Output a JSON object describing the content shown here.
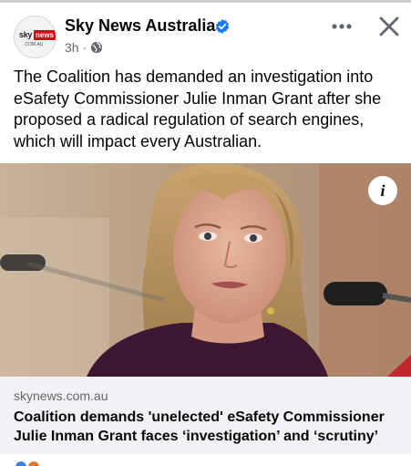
{
  "post": {
    "page_name": "Sky News Australia",
    "timestamp": "3h",
    "separator": "·",
    "avatar": {
      "sky": "sky",
      "news": "news",
      "domain": ".COM.AU"
    },
    "text": "The Coalition has demanded an investigation into eSafety Commissioner Julie Inman Grant after she proposed a radical regulation of search engines, which will impact every Australian.",
    "icons": {
      "verified": "verified-badge-icon",
      "audience": "globe-icon",
      "more": "more-options-icon",
      "close": "close-icon",
      "info": "info-icon"
    },
    "info_glyph": "i"
  },
  "link": {
    "domain": "skynews.com.au",
    "headline": "Coalition demands 'unelected' eSafety Commissioner Julie Inman Grant faces ‘investigation’ and ‘scrutiny’"
  },
  "colors": {
    "verified": "#1877f2",
    "secondary_text": "#65676b",
    "card_bg": "#f0f2f5",
    "sky_red": "#d10a11"
  }
}
